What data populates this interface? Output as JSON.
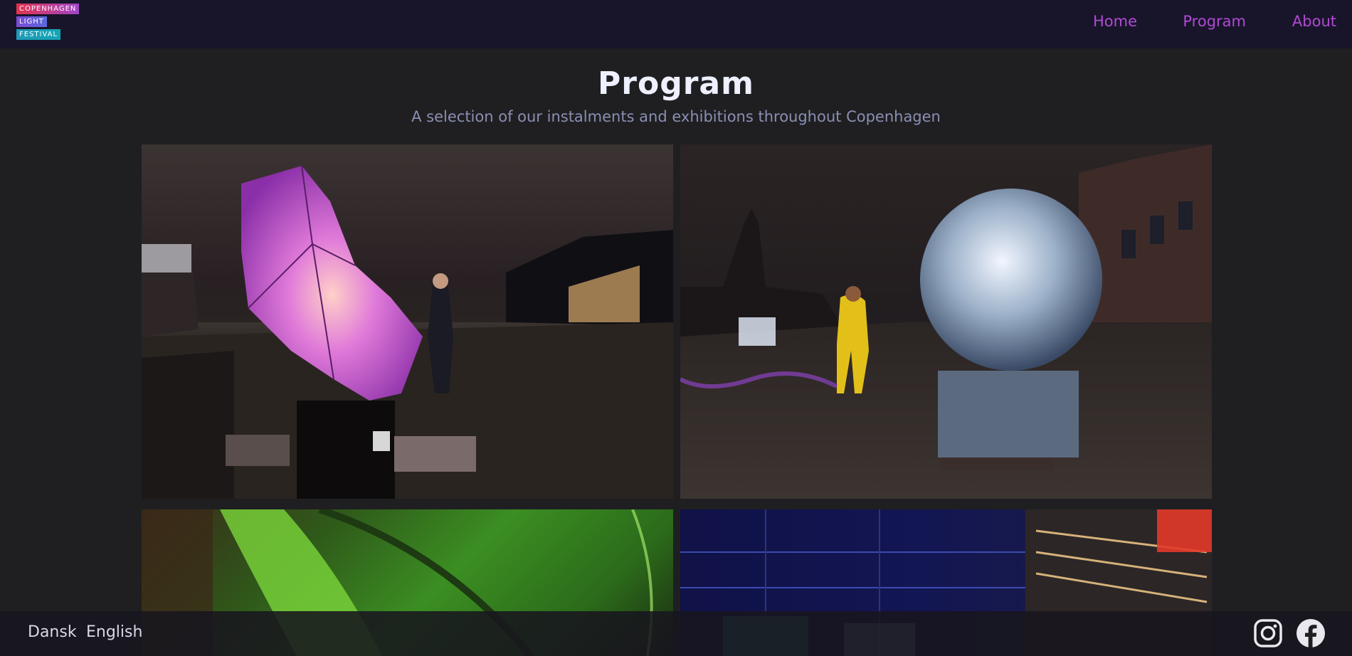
{
  "header": {
    "logo_lines": [
      "COPENHAGEN",
      "LIGHT",
      "FESTIVAL"
    ],
    "nav": [
      {
        "label": "Home"
      },
      {
        "label": "Program"
      },
      {
        "label": "About"
      }
    ]
  },
  "main": {
    "title": "Program",
    "subtitle": "A selection of our instalments and exhibitions throughout Copenhagen"
  },
  "footer": {
    "languages": [
      "Dansk",
      "English"
    ],
    "social_icons": [
      "instagram-icon",
      "facebook-icon"
    ]
  },
  "colors": {
    "topbar": "#18152b",
    "background": "#1f1f22",
    "nav_link": "#b04ad3",
    "title": "#eef0ff",
    "subtitle": "#8a8fb2"
  }
}
